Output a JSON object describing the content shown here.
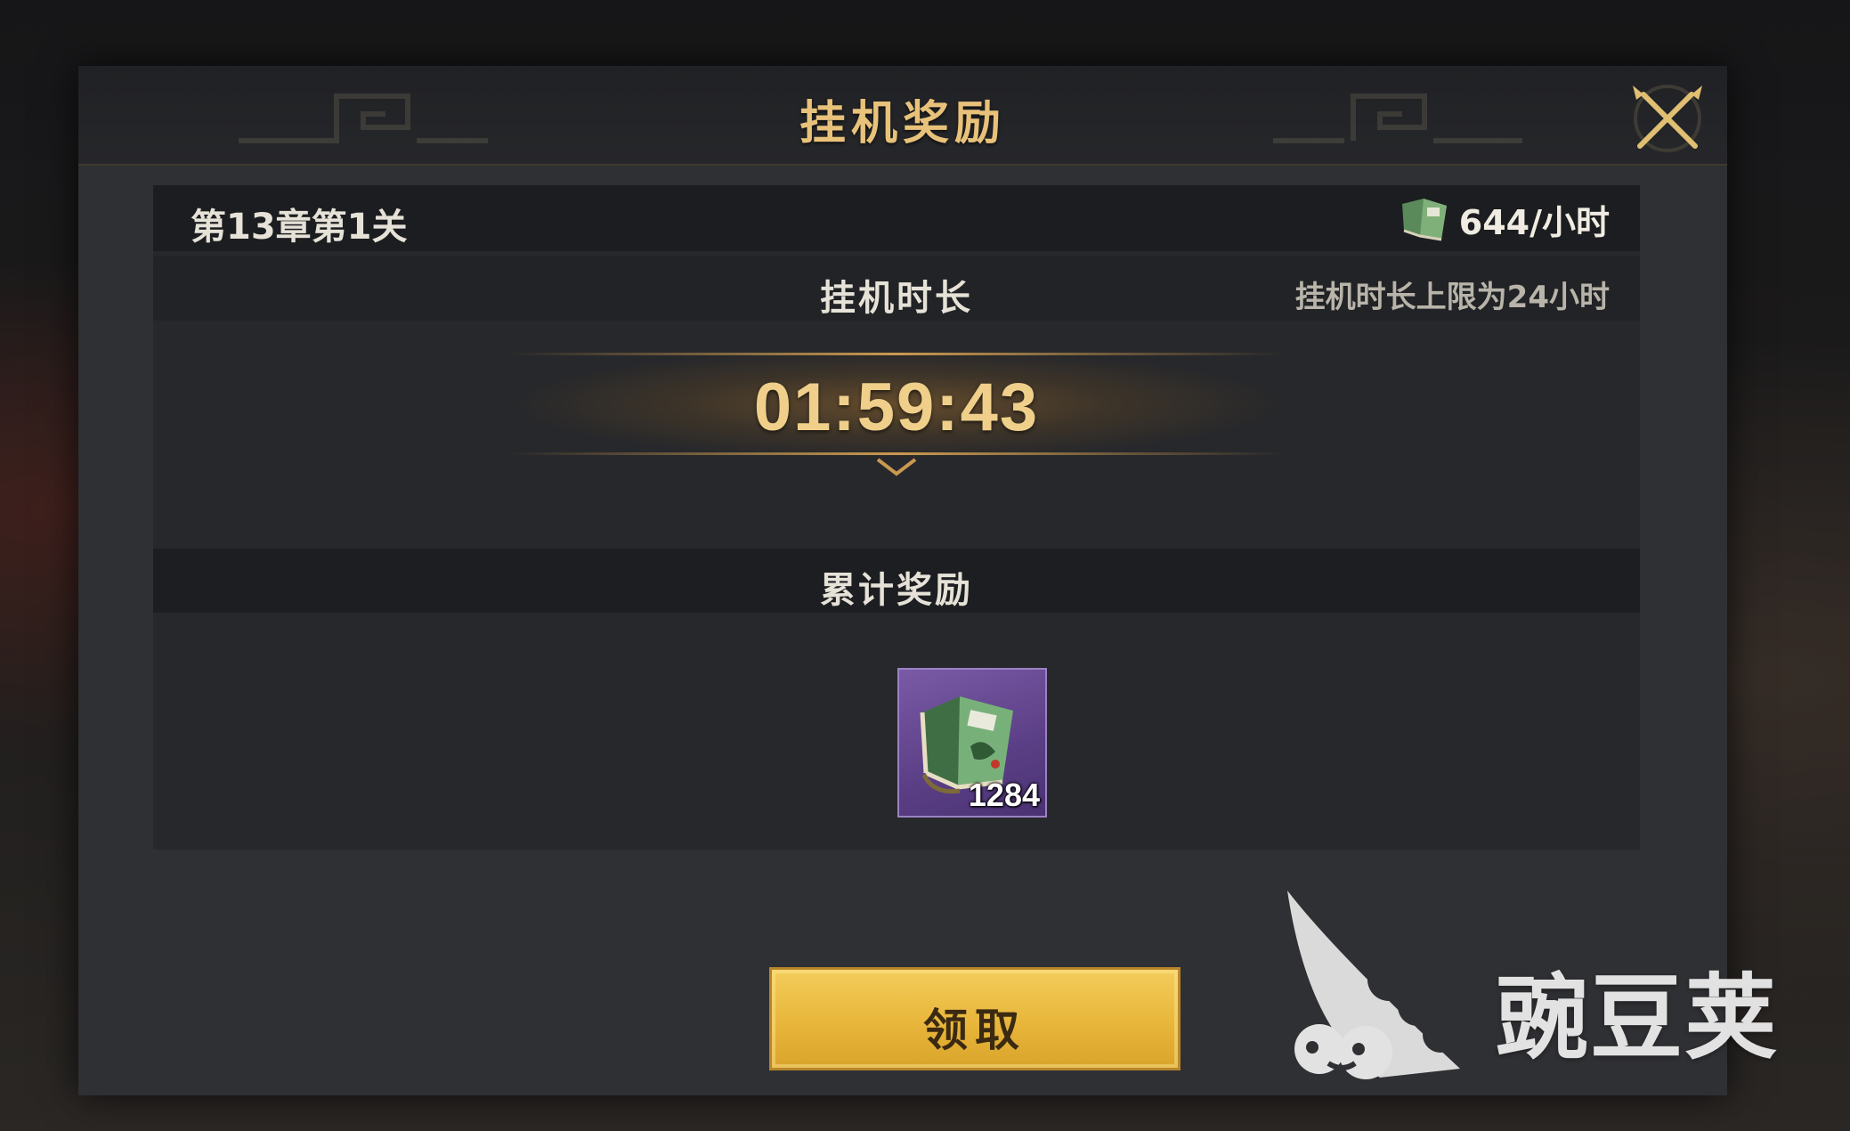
{
  "dialog": {
    "title": "挂机奖励"
  },
  "stage": {
    "name": "第13章第1关",
    "rate": "644/小时"
  },
  "duration": {
    "label": "挂机时长",
    "limit": "挂机时长上限为24小时",
    "timer": "01:59:43"
  },
  "rewards": {
    "label": "累计奖励",
    "items": [
      {
        "icon": "green-book-icon",
        "count": "1284"
      }
    ]
  },
  "actions": {
    "claim_label": "领取"
  },
  "watermark": {
    "text": "豌豆荚",
    "icon": "pea-pod-logo"
  },
  "colors": {
    "title_gold": "#e8c27a",
    "timer_gold": "#efcf8a",
    "button_gold": "#e8b63a",
    "item_purple": "#5b3f86"
  }
}
